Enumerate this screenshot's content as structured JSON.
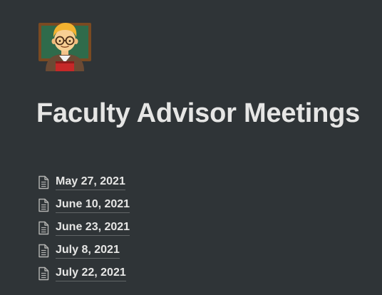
{
  "page": {
    "icon": "man-teacher-emoji",
    "title": "Faculty Advisor Meetings",
    "subpages": [
      {
        "label": "May 27, 2021",
        "icon": "document-icon"
      },
      {
        "label": "June 10, 2021",
        "icon": "document-icon"
      },
      {
        "label": "June 23, 2021",
        "icon": "document-icon"
      },
      {
        "label": "July 8, 2021",
        "icon": "document-icon"
      },
      {
        "label": "July 22, 2021",
        "icon": "document-icon"
      }
    ]
  },
  "colors": {
    "background": "#2f3437",
    "text": "#e6e6e5",
    "icon": "#b4b4b2"
  }
}
